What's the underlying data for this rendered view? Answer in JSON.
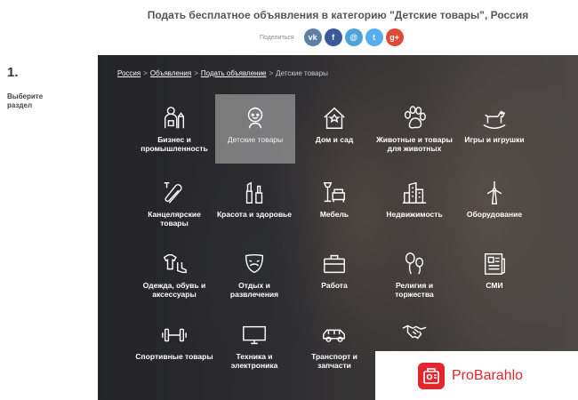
{
  "header": {
    "title": "Подать бесплатное объявления в категорию \"Детские товары\", Россия",
    "share_label": "Поделиться",
    "social": [
      {
        "name": "vk",
        "glyph": "vk",
        "color": "#5b7fa6"
      },
      {
        "name": "facebook",
        "glyph": "f",
        "color": "#3b5998"
      },
      {
        "name": "odnoklassniki",
        "glyph": "@",
        "color": "#4ea3d8"
      },
      {
        "name": "twitter",
        "glyph": "t",
        "color": "#55acee"
      },
      {
        "name": "google-plus",
        "glyph": "g+",
        "color": "#dc4a38"
      }
    ]
  },
  "step": {
    "number": "1.",
    "label": "Выберите раздел"
  },
  "breadcrumb": {
    "items": [
      "Россия",
      "Объявления",
      "Подать объявление"
    ],
    "separator": ">",
    "current": "Детские товары"
  },
  "categories": [
    {
      "label": "Бизнес и промышленность",
      "icon": "business-icon"
    },
    {
      "label": "Детские товары",
      "icon": "baby-icon",
      "active": true
    },
    {
      "label": "Дом и сад",
      "icon": "house-icon"
    },
    {
      "label": "Животные и товары для животных",
      "icon": "paw-icon"
    },
    {
      "label": "Игры и игрушки",
      "icon": "rocking-horse-icon"
    },
    {
      "label": "Канцелярские товары",
      "icon": "paperclip-icon"
    },
    {
      "label": "Красота и здоровье",
      "icon": "cosmetics-icon"
    },
    {
      "label": "Мебель",
      "icon": "furniture-icon"
    },
    {
      "label": "Недвижимость",
      "icon": "buildings-icon"
    },
    {
      "label": "Оборудование",
      "icon": "wind-turbine-icon"
    },
    {
      "label": "Одежда, обувь и аксессуары",
      "icon": "clothes-icon"
    },
    {
      "label": "Отдых и развлечения",
      "icon": "theater-mask-icon"
    },
    {
      "label": "Работа",
      "icon": "briefcase-icon"
    },
    {
      "label": "Религия и торжества",
      "icon": "balloons-icon"
    },
    {
      "label": "СМИ",
      "icon": "newspaper-icon"
    },
    {
      "label": "Спортивные товары",
      "icon": "dumbbell-icon"
    },
    {
      "label": "Техника и электроника",
      "icon": "monitor-icon"
    },
    {
      "label": "Транспорт и запчасти",
      "icon": "car-icon"
    },
    {
      "label": "",
      "icon": "handshake-icon"
    }
  ],
  "badge": {
    "text": "ProBarahlo",
    "color": "#e1262d"
  }
}
